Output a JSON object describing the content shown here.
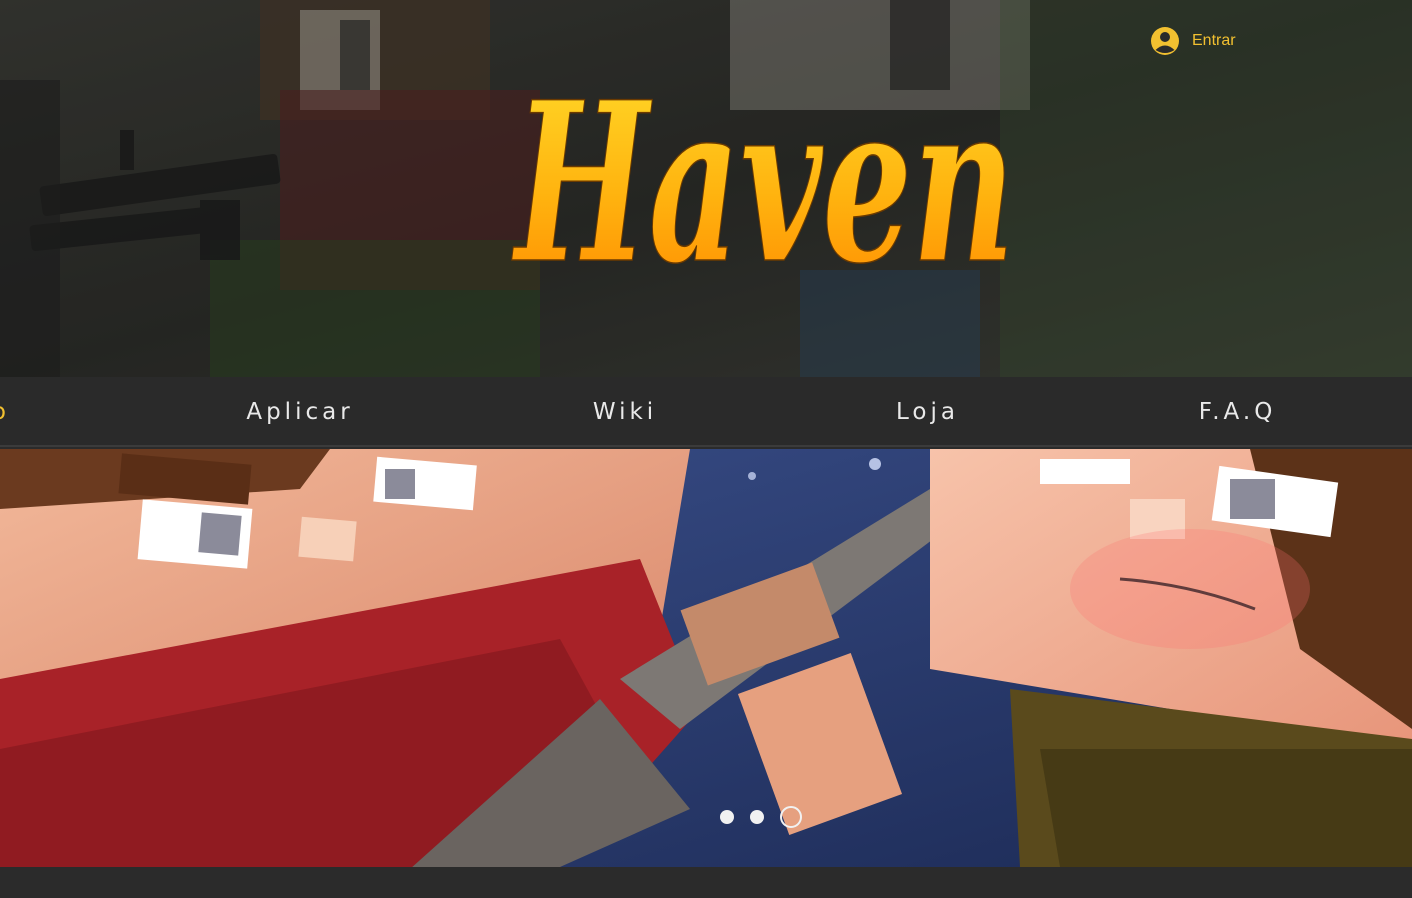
{
  "header": {
    "logo_text": "Haven",
    "login_label": "Entrar",
    "login_icon": "user-avatar-icon"
  },
  "nav": {
    "items": [
      {
        "label": "o"
      },
      {
        "label": "Aplicar"
      },
      {
        "label": "Wiki"
      },
      {
        "label": "Loja"
      },
      {
        "label": "F.A.Q"
      }
    ]
  },
  "slideshow": {
    "slide_count": 3,
    "active_index": 2
  },
  "colors": {
    "accent": "#f2c030",
    "nav_bg": "#2a2a2a",
    "page_bg": "#2b2b2b",
    "logo_top": "#ffd21f",
    "logo_bottom": "#ff8a00"
  }
}
